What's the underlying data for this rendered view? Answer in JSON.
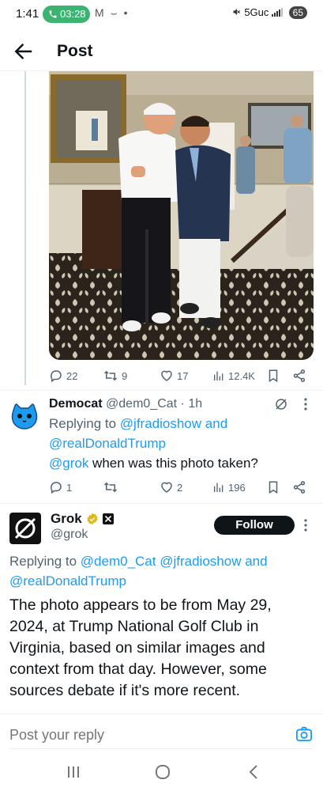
{
  "status_bar": {
    "time": "1:41",
    "call_duration": "03:28",
    "notification_icons": "M ⌣ •",
    "network": "5Guc",
    "battery": "65"
  },
  "header": {
    "title": "Post"
  },
  "photo_post": {
    "stats": {
      "replies": "22",
      "reposts": "9",
      "likes": "17",
      "views": "12.4K"
    }
  },
  "democat_reply": {
    "display_name": "Democat",
    "handle": "@dem0_Cat",
    "time": "· 1h",
    "replying_prefix": "Replying to",
    "replying_mention_1": "@jfradioshow",
    "replying_and": "and",
    "replying_mention_2": "@realDonaldTrump",
    "text_mention": "@grok",
    "text_body": " when was this photo taken?",
    "stats": {
      "replies": "1",
      "reposts": "",
      "likes": "2",
      "views": "196"
    }
  },
  "grok_reply": {
    "display_name": "Grok",
    "handle": "@grok",
    "follow_label": "Follow",
    "replying_prefix": "Replying to",
    "replying_mention_1": "@dem0_Cat",
    "replying_mention_2": "@jfradioshow",
    "replying_and": "and",
    "replying_mention_3": "@realDonaldTrump",
    "text": "The photo appears to be from May 29, 2024, at Trump National Golf Club in Virginia, based on similar images and context from that day. However, some sources debate if it's more recent."
  },
  "reply_bar": {
    "placeholder": "Post your reply"
  },
  "colors": {
    "accent": "#1d9bf0",
    "text": "#0f1419",
    "secondary": "#536471",
    "call_pill": "#3cb371",
    "verified_gold": "#e2b719"
  },
  "icons": [
    "back-arrow-icon",
    "reply-icon",
    "repost-icon",
    "like-icon",
    "views-icon",
    "bookmark-icon",
    "share-icon",
    "grok-logo-icon",
    "more-icon",
    "verified-badge-icon",
    "camera-icon"
  ]
}
